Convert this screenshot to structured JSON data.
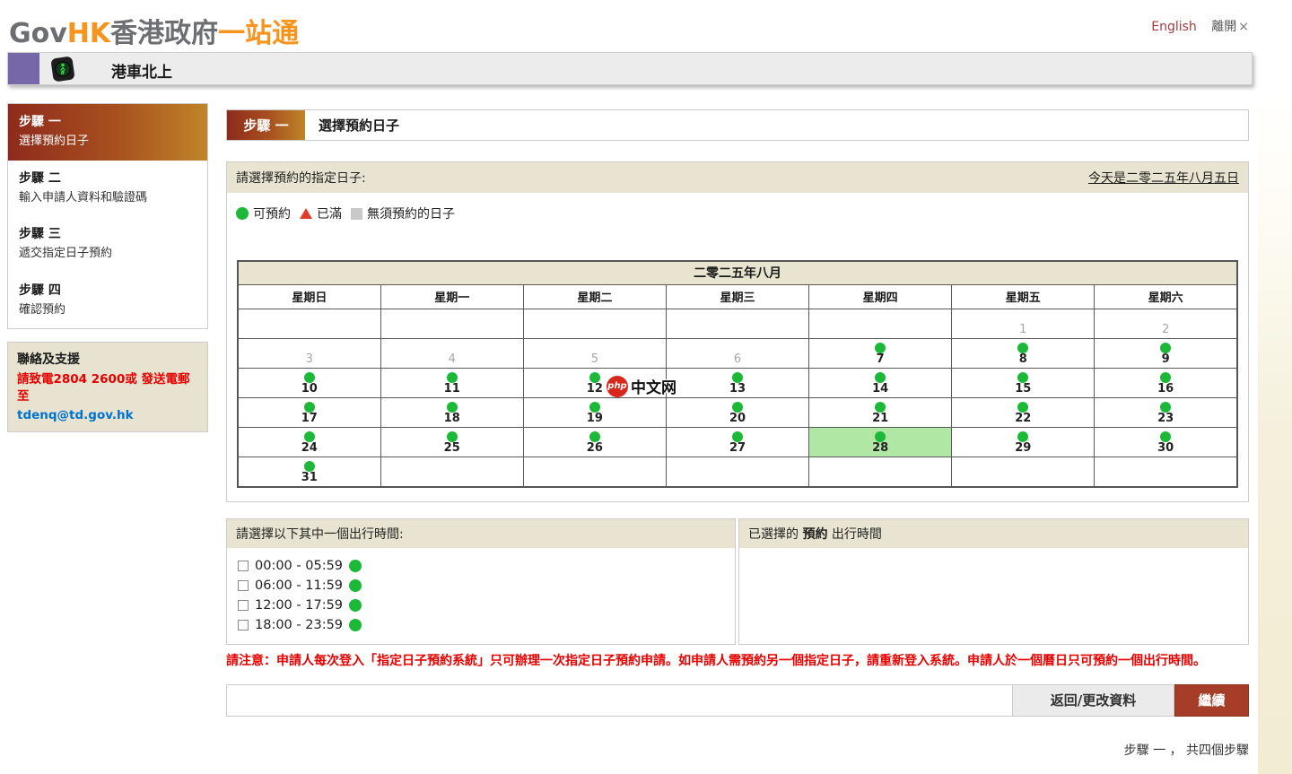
{
  "header": {
    "logo_gov": "Gov",
    "logo_hk": "HK",
    "logo_cn_gray": "香港政府",
    "logo_cn_orange": "一站通",
    "english_link": "English",
    "exit_label": "離開",
    "exit_icon": "×"
  },
  "banner": {
    "title": "港車北上"
  },
  "sidebar": {
    "steps": [
      {
        "num": "步驟 一",
        "label": "選擇預約日子",
        "active": true
      },
      {
        "num": "步驟 二",
        "label": "輸入申請人資料和驗證碼",
        "active": false
      },
      {
        "num": "步驟 三",
        "label": "遞交指定日子預約",
        "active": false
      },
      {
        "num": "步驟 四",
        "label": "確認預約",
        "active": false
      }
    ],
    "contact": {
      "title": "聯絡及支援",
      "line1": "請致電2804 2600或 發送電郵至",
      "email": "tdenq@td.gov.hk"
    }
  },
  "main": {
    "step_badge": "步驟 一",
    "step_title": "選擇預約日子",
    "calendar_panel": {
      "prompt": "請選擇預約的指定日子:",
      "today_link": "今天是二零二五年八月五日",
      "legend": [
        {
          "icon": "green-circle-icon",
          "label": "可預約"
        },
        {
          "icon": "red-triangle-icon",
          "label": "已滿"
        },
        {
          "icon": "gray-square-icon",
          "label": "無須預約的日子"
        }
      ],
      "month_title": "二零二五年八月",
      "weekdays": [
        "星期日",
        "星期一",
        "星期二",
        "星期三",
        "星期四",
        "星期五",
        "星期六"
      ],
      "weeks": [
        [
          {
            "day": ""
          },
          {
            "day": ""
          },
          {
            "day": ""
          },
          {
            "day": ""
          },
          {
            "day": ""
          },
          {
            "day": "1",
            "state": "disabled"
          },
          {
            "day": "2",
            "state": "disabled"
          }
        ],
        [
          {
            "day": "3",
            "state": "disabled"
          },
          {
            "day": "4",
            "state": "disabled"
          },
          {
            "day": "5",
            "state": "disabled"
          },
          {
            "day": "6",
            "state": "disabled"
          },
          {
            "day": "7",
            "state": "available"
          },
          {
            "day": "8",
            "state": "available"
          },
          {
            "day": "9",
            "state": "available"
          }
        ],
        [
          {
            "day": "10",
            "state": "available"
          },
          {
            "day": "11",
            "state": "available"
          },
          {
            "day": "12",
            "state": "available"
          },
          {
            "day": "13",
            "state": "available"
          },
          {
            "day": "14",
            "state": "available"
          },
          {
            "day": "15",
            "state": "available"
          },
          {
            "day": "16",
            "state": "available"
          }
        ],
        [
          {
            "day": "17",
            "state": "available"
          },
          {
            "day": "18",
            "state": "available"
          },
          {
            "day": "19",
            "state": "available"
          },
          {
            "day": "20",
            "state": "available"
          },
          {
            "day": "21",
            "state": "available"
          },
          {
            "day": "22",
            "state": "available"
          },
          {
            "day": "23",
            "state": "available"
          }
        ],
        [
          {
            "day": "24",
            "state": "available"
          },
          {
            "day": "25",
            "state": "available"
          },
          {
            "day": "26",
            "state": "available"
          },
          {
            "day": "27",
            "state": "available"
          },
          {
            "day": "28",
            "state": "selected"
          },
          {
            "day": "29",
            "state": "available"
          },
          {
            "day": "30",
            "state": "available"
          }
        ],
        [
          {
            "day": "31",
            "state": "available"
          },
          {
            "day": ""
          },
          {
            "day": ""
          },
          {
            "day": ""
          },
          {
            "day": ""
          },
          {
            "day": ""
          },
          {
            "day": ""
          }
        ]
      ]
    },
    "time_panel": {
      "title": "請選擇以下其中一個出行時間:",
      "options": [
        "00:00 - 05:59",
        "06:00 - 11:59",
        "12:00 - 17:59",
        "18:00 - 23:59"
      ]
    },
    "selected_panel": {
      "pre": "已選擇的",
      "bold": "預約",
      "post": "出行時間"
    },
    "notice": "請注意：申請人每次登入「指定日子預約系統」只可辦理一次指定日子預約申請。如申請人需預約另一個指定日子，請重新登入系統。申請人於一個曆日只可預約一個出行時間。",
    "buttons": {
      "back": "返回/更改資料",
      "continue": "繼續"
    },
    "footer_step": "步驟 一 ， 共四個步驟"
  },
  "watermark": {
    "badge": "php",
    "text": "中文网"
  },
  "colors": {
    "accent_orange": "#f7941d",
    "active_step_gradient_start": "#8e2a1d",
    "active_step_gradient_end": "#c08429",
    "continue_button": "#a53d29",
    "available_green": "#1cb837",
    "selected_day_bg": "#b0e7a5",
    "notice_red": "#e60000",
    "email_link_blue": "#0073cf",
    "panel_header_beige": "#e9e4d1",
    "purple_block": "#7668a8"
  }
}
